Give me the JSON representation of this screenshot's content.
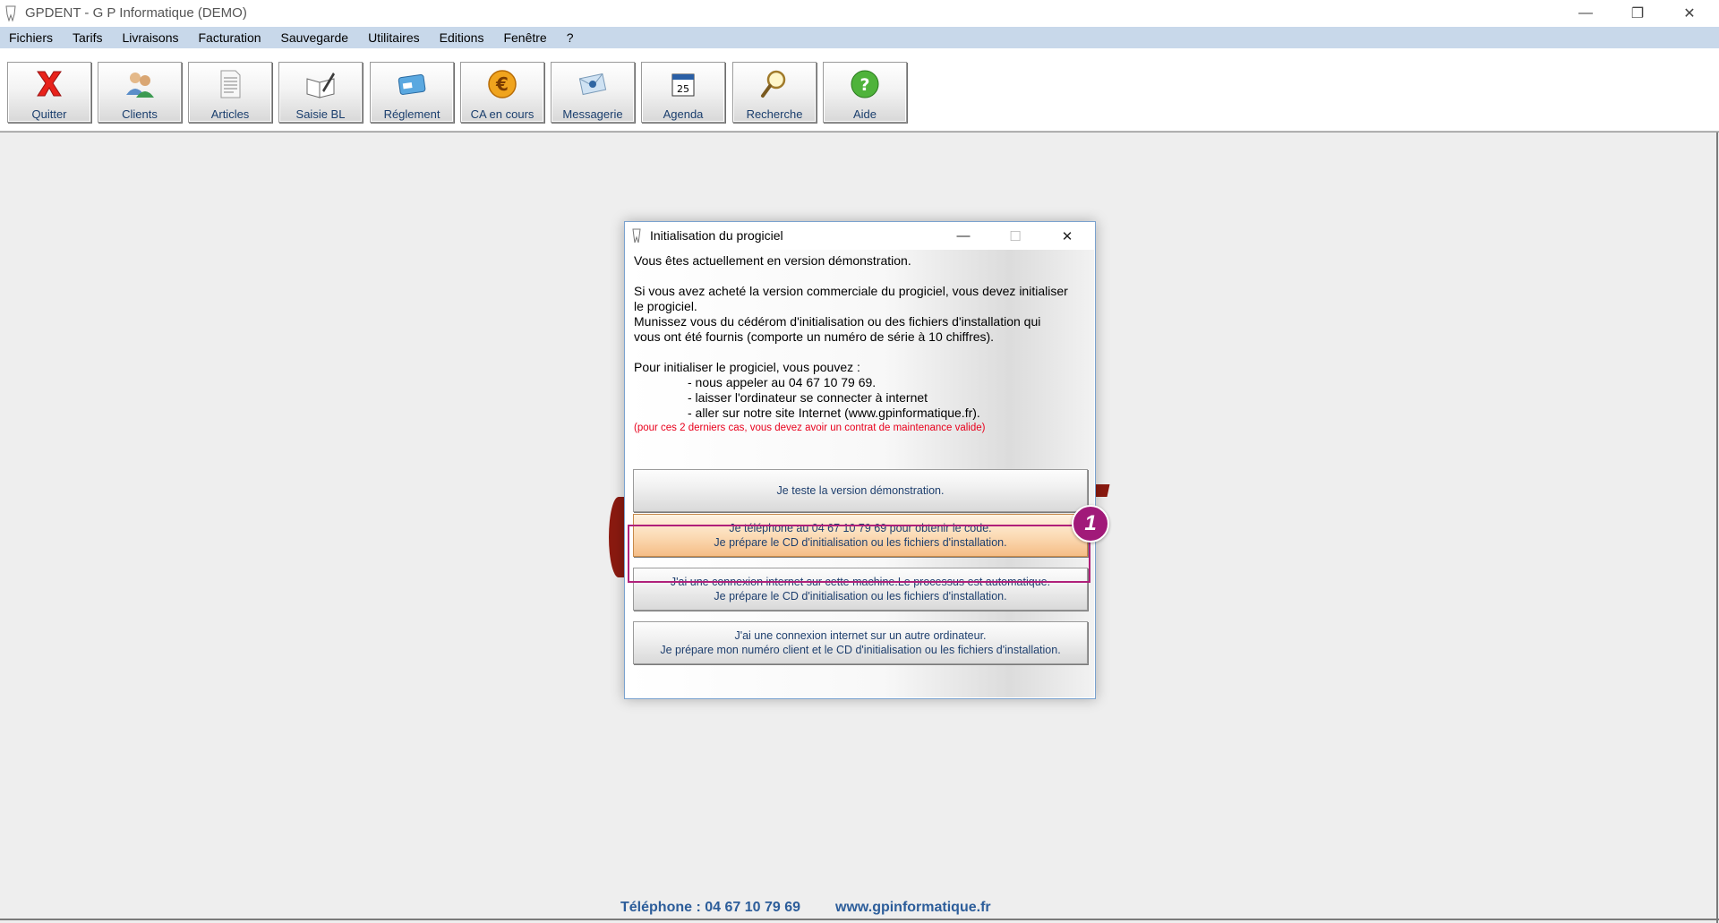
{
  "window": {
    "title": "GPDENT  -  G P Informatique  (DEMO)",
    "minimize_glyph": "—",
    "maximize_glyph": "❐",
    "close_glyph": "✕"
  },
  "menu": {
    "items": [
      "Fichiers",
      "Tarifs",
      "Livraisons",
      "Facturation",
      "Sauvegarde",
      "Utilitaires",
      "Editions",
      "Fenêtre",
      "?"
    ]
  },
  "toolbar": {
    "buttons": [
      {
        "label": "Quitter",
        "icon": "close-x-icon"
      },
      {
        "label": "Clients",
        "icon": "users-icon"
      },
      {
        "label": "Articles",
        "icon": "document-icon"
      },
      {
        "label": "Saisie BL",
        "icon": "book-pen-icon"
      },
      {
        "label": "Réglement",
        "icon": "card-payment-icon"
      },
      {
        "label": "CA en cours",
        "icon": "euro-coin-icon"
      },
      {
        "label": "Messagerie",
        "icon": "envelope-icon"
      },
      {
        "label": "Agenda",
        "icon": "calendar-icon"
      },
      {
        "label": "Recherche",
        "icon": "magnifier-icon"
      },
      {
        "label": "Aide",
        "icon": "help-icon"
      }
    ],
    "calendar_day": "25"
  },
  "dialog": {
    "title": "Initialisation du progiciel",
    "close_glyph": "✕",
    "min_glyph": "—",
    "max_glyph": "☐",
    "line_demo": "Vous êtes actuellement en version démonstration.",
    "para1_line1": "Si vous avez acheté la version commerciale du progiciel, vous devez initialiser",
    "para1_line2": "le progiciel.",
    "para1_line3": "Munissez vous du cédérom d'initialisation ou des fichiers d'installation qui",
    "para1_line4": "vous ont été fournis (comporte un numéro de série à 10 chiffres).",
    "para2_intro": "Pour initialiser le progiciel, vous pouvez :",
    "para2_opt1": "- nous appeler au 04 67 10 79 69.",
    "para2_opt2": "- laisser l'ordinateur se connecter à internet",
    "para2_opt3": "- aller sur notre site Internet (www.gpinformatique.fr).",
    "note": "(pour ces 2 derniers cas, vous devez avoir un contrat de maintenance valide)",
    "options": [
      {
        "line1": "Je teste la version démonstration.",
        "line2": ""
      },
      {
        "line1": "Je téléphone au 04 67 10 79 69 pour obtenir le code.",
        "line2": "Je prépare le CD d'initialisation ou les fichiers d'installation."
      },
      {
        "line1": "J'ai une connexion internet sur cette machine.Le processus est automatique.",
        "line2": "Je prépare le CD d'initialisation ou les fichiers d'installation."
      },
      {
        "line1": "J'ai une connexion internet sur un autre ordinateur.",
        "line2": "Je prépare mon numéro client et le CD d'initialisation ou les fichiers d'installation."
      }
    ],
    "selected_option_index": 1
  },
  "callout": {
    "number": "1",
    "color": "#a11a79"
  },
  "footer": {
    "phone": "Téléphone : 04 67 10 79 69",
    "website": "www.gpinformatique.fr"
  },
  "colors": {
    "menubar": "#c8d8ea",
    "label_blue": "#1a3e6d",
    "footer_blue": "#2c5d9a",
    "note_red": "#e8001c",
    "selected_orange": "#f5bd86"
  }
}
